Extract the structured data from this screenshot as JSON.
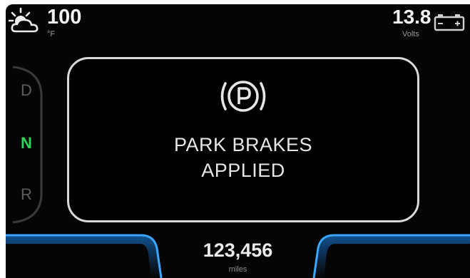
{
  "status_bar": {
    "outside_temperature": "100",
    "temperature_unit": "°F",
    "temperature_icon": "sun-cloud-icon",
    "battery_voltage": "13.8",
    "voltage_unit": "Volts",
    "voltage_icon": "battery-icon"
  },
  "gear_selector": {
    "gears": [
      "D",
      "N",
      "R"
    ],
    "selected": "N",
    "selected_color": "#29d657"
  },
  "message": {
    "icon": "parking-brake-icon",
    "line1": "PARK BRAKES",
    "line2": "APPLIED"
  },
  "odometer": {
    "value": "123,456",
    "unit": "miles"
  },
  "colors": {
    "background": "#050505",
    "accent_glow": "#1e8fff",
    "panel_border": "#d9d9d9"
  }
}
